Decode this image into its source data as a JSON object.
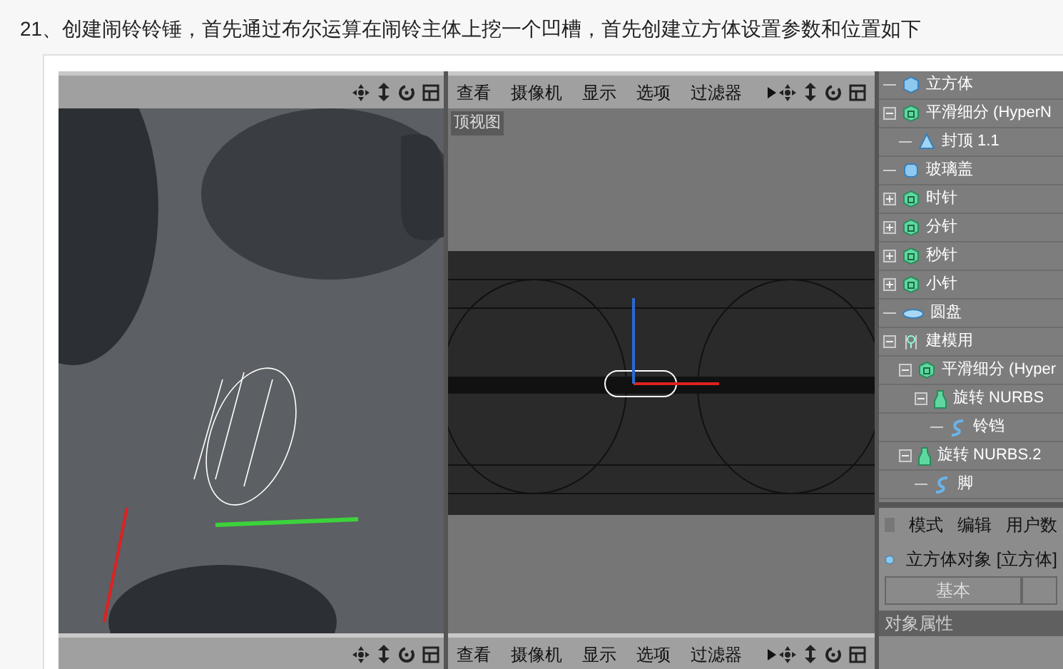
{
  "heading": "21、创建闹铃铃锤，首先通过布尔运算在闹铃主体上挖一个凹槽，首先创建立方体设置参数和位置如下",
  "top_view": {
    "menu": [
      "查看",
      "摄像机",
      "显示",
      "选项",
      "过滤器"
    ],
    "label": "顶视图"
  },
  "object_tree": [
    {
      "name": "立方体",
      "kind": "cube"
    },
    {
      "name": "平滑细分 (HyperN",
      "kind": "subdivision",
      "expanded": true,
      "children": [
        {
          "name": "封顶 1.1",
          "kind": "cap"
        }
      ]
    },
    {
      "name": "玻璃盖",
      "kind": "cylinder"
    },
    {
      "name": "时针",
      "kind": "subdivision",
      "expanded": false
    },
    {
      "name": "分针",
      "kind": "subdivision",
      "expanded": false
    },
    {
      "name": "秒针",
      "kind": "subdivision",
      "expanded": false
    },
    {
      "name": "小针",
      "kind": "subdivision",
      "expanded": false
    },
    {
      "name": "圆盘",
      "kind": "disc"
    },
    {
      "name": "建模用",
      "kind": "null",
      "expanded": true,
      "children": [
        {
          "name": "平滑细分 (Hyper",
          "kind": "subdivision",
          "expanded": true,
          "children": [
            {
              "name": "旋转 NURBS",
              "kind": "lathe",
              "expanded": true,
              "children": [
                {
                  "name": "铃铛",
                  "kind": "spline"
                }
              ]
            }
          ]
        },
        {
          "name": "旋转 NURBS.2",
          "kind": "lathe",
          "expanded": true,
          "children": [
            {
              "name": "脚",
              "kind": "spline"
            }
          ]
        }
      ]
    }
  ],
  "attributes": {
    "menu": [
      "模式",
      "编辑",
      "用户数"
    ],
    "object": "立方体对象 [立方体]",
    "tab": "基本",
    "section": "对象属性"
  },
  "bottom_toolbar": {
    "menu": [
      "查看",
      "摄像机",
      "显示",
      "选项",
      "过滤器"
    ]
  }
}
